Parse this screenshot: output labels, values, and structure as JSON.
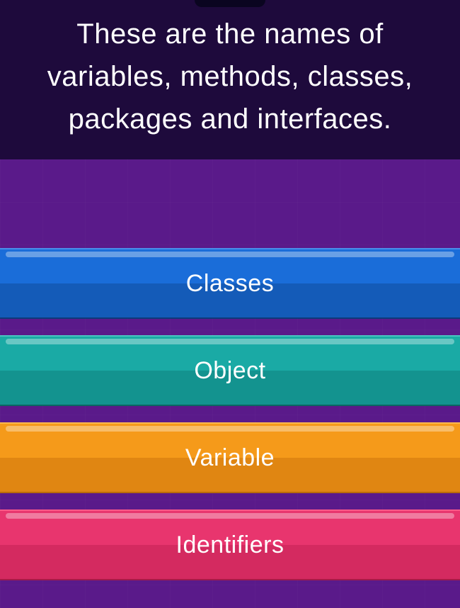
{
  "question": {
    "text": "These are the names of variables, methods, classes, packages and interfaces."
  },
  "answers": [
    {
      "label": "Classes",
      "color": "blue"
    },
    {
      "label": "Object",
      "color": "teal"
    },
    {
      "label": "Variable",
      "color": "orange"
    },
    {
      "label": "Identifiers",
      "color": "pink"
    }
  ]
}
